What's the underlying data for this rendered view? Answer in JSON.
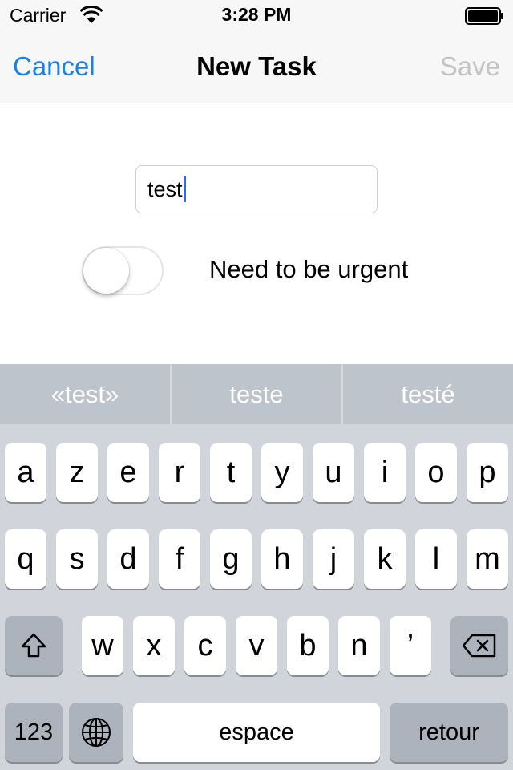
{
  "status_bar": {
    "carrier": "Carrier",
    "time": "3:28 PM"
  },
  "nav": {
    "cancel_label": "Cancel",
    "title": "New Task",
    "save_label": "Save"
  },
  "form": {
    "task_value": "test",
    "urgent_label": "Need to be urgent",
    "urgent_on": false
  },
  "keyboard": {
    "suggestions": [
      "«test»",
      "teste",
      "testé"
    ],
    "row1": [
      "a",
      "z",
      "e",
      "r",
      "t",
      "y",
      "u",
      "i",
      "o",
      "p"
    ],
    "row2": [
      "q",
      "s",
      "d",
      "f",
      "g",
      "h",
      "j",
      "k",
      "l",
      "m"
    ],
    "row3": [
      "w",
      "x",
      "c",
      "v",
      "b",
      "n",
      "’"
    ],
    "numbers_label": "123",
    "space_label": "espace",
    "return_label": "retour",
    "icons": {
      "shift": "shift-icon",
      "delete": "backspace-icon",
      "globe": "globe-icon"
    }
  },
  "colors": {
    "accent": "#1a82e6",
    "disabled": "#c4c4c4",
    "caret": "#2c68f0",
    "keyboard_bg": "#d1d5db"
  }
}
